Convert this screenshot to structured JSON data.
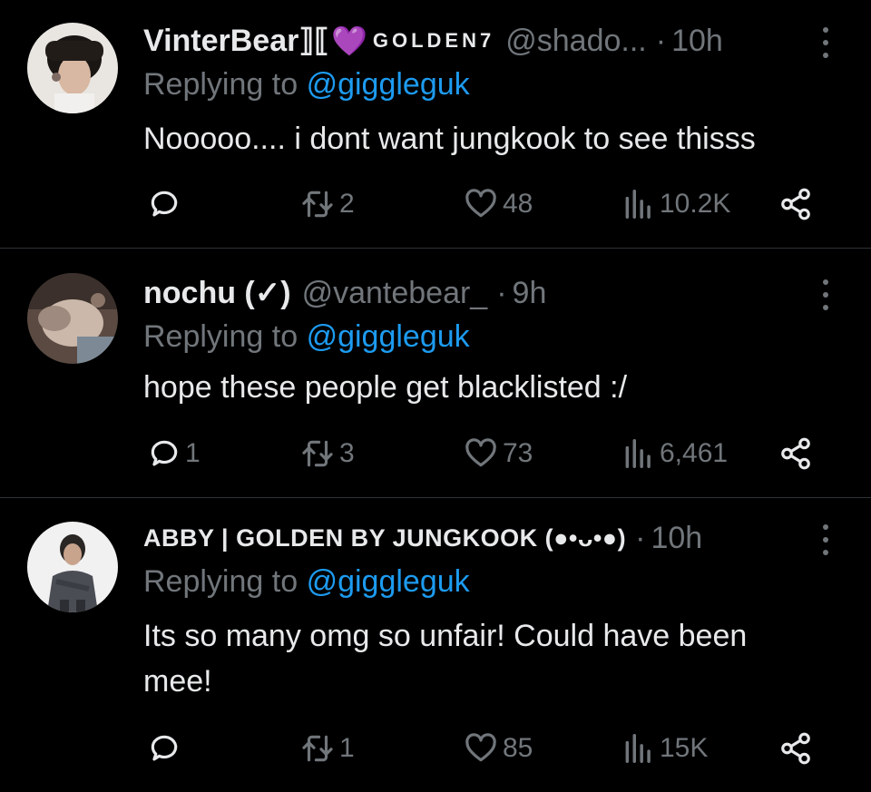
{
  "tweets": [
    {
      "name": "VinterBear",
      "name_glyphs": "⟧⟦",
      "heart": "💜",
      "badge": "GOLDEN7",
      "handle": "@shado...",
      "dot": "·",
      "time": "10h",
      "replying_prefix": "Replying to",
      "mention": "@giggleguk",
      "text": "Nooooo.... i dont want jungkook to see thisss",
      "replies": "",
      "reposts": "2",
      "likes": "48",
      "views": "10.2K"
    },
    {
      "name": "nochu (✓)",
      "handle": "@vantebear_",
      "dot": "·",
      "time": "9h",
      "replying_prefix": "Replying to",
      "mention": "@giggleguk",
      "text": "hope these people get blacklisted :/",
      "replies": "1",
      "reposts": "3",
      "likes": "73",
      "views": "6,461"
    },
    {
      "name": "ABBY | GOLDEN BY JUNGKOOK (●•ᴗ•●)",
      "dot": "·",
      "time": "10h",
      "replying_prefix": "Replying to",
      "mention": "@giggleguk",
      "text": "Its so many omg so unfair! Could have been mee!",
      "replies": "",
      "reposts": "1",
      "likes": "85",
      "views": "15K"
    }
  ],
  "icons": {
    "reply": "reply-icon",
    "repost": "repost-icon",
    "like": "heart-icon",
    "views": "views-icon",
    "share": "share-icon",
    "more": "more-icon"
  },
  "colors": {
    "background": "#000000",
    "text": "#e7e9ea",
    "muted": "#71767b",
    "link": "#1d9bf0",
    "divider": "#2f3336",
    "heart_purple": "#a855f7"
  }
}
